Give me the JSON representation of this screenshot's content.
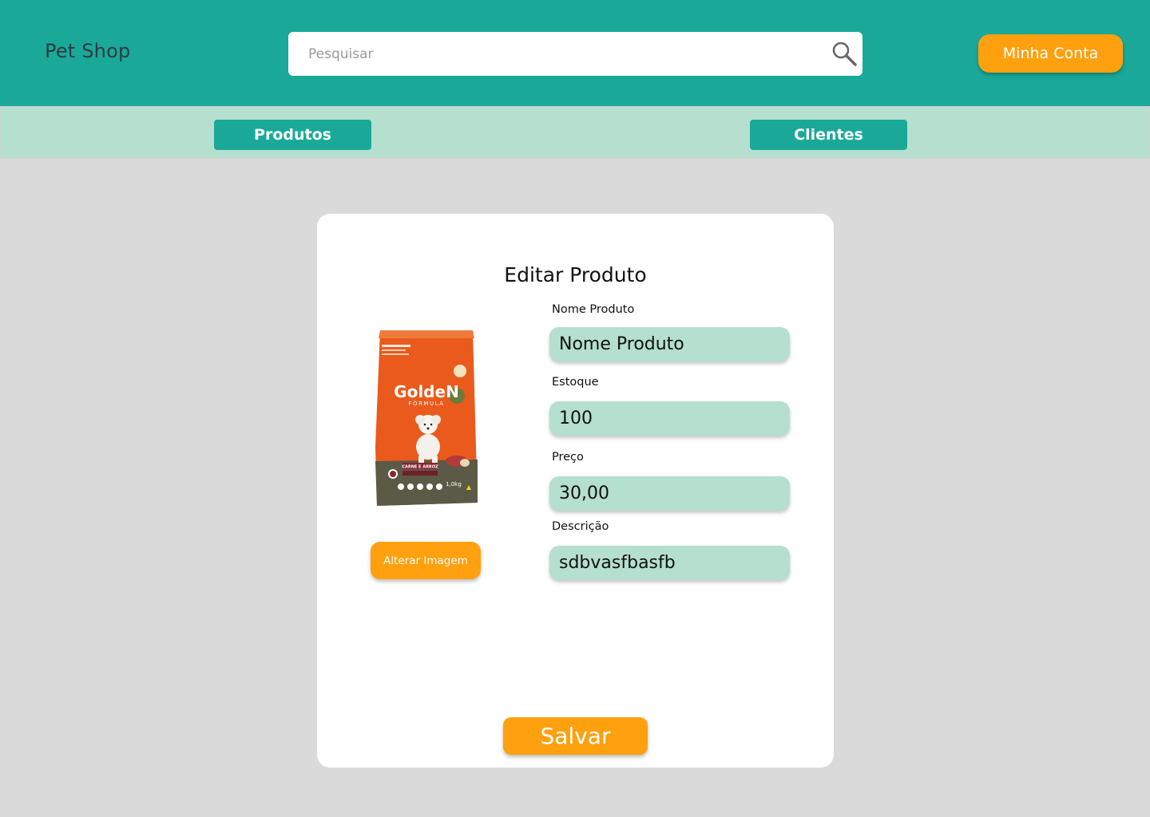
{
  "header": {
    "brand": "Pet Shop",
    "search_placeholder": "Pesquisar",
    "search_icon": "search-icon",
    "account_label": "Minha Conta"
  },
  "nav": {
    "tabs": [
      {
        "label": "Produtos"
      },
      {
        "label": "Clientes"
      }
    ]
  },
  "form": {
    "title": "Editar Produto",
    "change_image_label": "Alterar Imagem",
    "product_image": {
      "brand_text": "GoldeN",
      "sub_text": "FÓRMULA",
      "flavor_text": "CARNE E ARROZ",
      "weight_text": "1,0kg"
    },
    "fields": [
      {
        "label": "Nome Produto",
        "value": "Nome Produto"
      },
      {
        "label": "Estoque",
        "value": "100"
      },
      {
        "label": "Preço",
        "value": "30,00"
      },
      {
        "label": "Descrição",
        "value": "sdbvasfbasfb"
      }
    ],
    "save_label": "Salvar"
  },
  "colors": {
    "header_bg": "#1aa999",
    "nav_bg": "#b5dfcf",
    "accent": "#ffa00f",
    "page_bg": "#dadada",
    "field_bg": "#b5dfcf"
  }
}
